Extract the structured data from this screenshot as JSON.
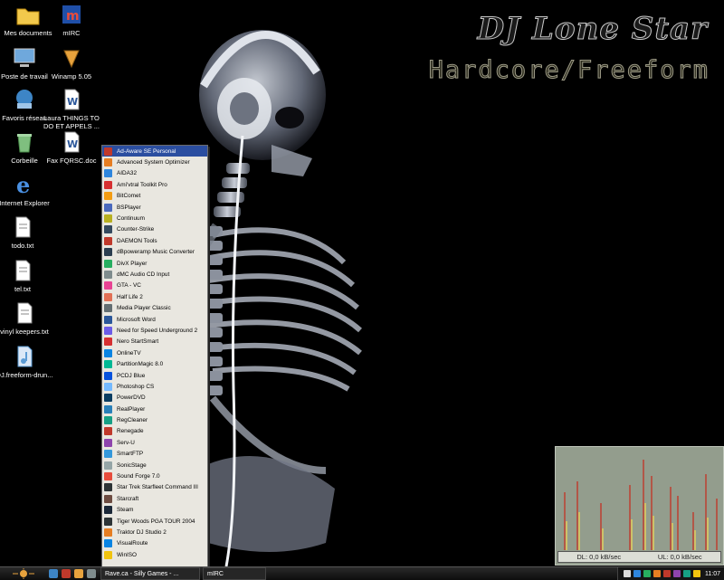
{
  "wallpaper": {
    "title": "DJ Lone Star",
    "subtitle": "Hardcore/Freeform"
  },
  "desktop_icons": [
    {
      "label": "Mes documents",
      "icon": "folder-icon",
      "color": "#f2c94c"
    },
    {
      "label": "Poste de travail",
      "icon": "computer-icon",
      "color": "#6fa8dc"
    },
    {
      "label": "Favoris réseau",
      "icon": "network-icon",
      "color": "#3d85c6"
    },
    {
      "label": "Corbeille",
      "icon": "recycle-bin-icon",
      "color": "#7fbf7f"
    },
    {
      "label": "Internet Explorer",
      "icon": "internet-explorer-icon",
      "color": "#4a90e2"
    },
    {
      "label": "todo.txt",
      "icon": "text-file-icon",
      "color": "#ffffff"
    },
    {
      "label": "tel.txt",
      "icon": "text-file-icon",
      "color": "#ffffff"
    },
    {
      "label": "vinyl keepers.txt",
      "icon": "text-file-icon",
      "color": "#ffffff"
    },
    {
      "label": "DJ.freeform-drun...",
      "icon": "audio-file-icon",
      "color": "#5b9bd5"
    },
    {
      "label": "mIRC",
      "icon": "mirc-icon",
      "color": "#1f4fa8"
    },
    {
      "label": "Winamp 5.05",
      "icon": "winamp-icon",
      "color": "#e8a33d"
    },
    {
      "label": "Laura THINGS TO DO ET APPELS ...",
      "icon": "word-doc-icon",
      "color": "#2b579a"
    },
    {
      "label": "Fax FQRSC.doc",
      "icon": "word-doc-icon",
      "color": "#2b579a"
    }
  ],
  "start_menu": {
    "items": [
      {
        "label": "Ad-Aware SE Personal",
        "icon": "ad-aware-icon",
        "color": "#c0392b"
      },
      {
        "label": "Advanced System Optimizer",
        "icon": "optimizer-icon",
        "color": "#e67e22"
      },
      {
        "label": "AIDA32",
        "icon": "aida32-icon",
        "color": "#2e86de"
      },
      {
        "label": "Ami'vtral Toolkit Pro",
        "icon": "toolkit-icon",
        "color": "#d63031"
      },
      {
        "label": "BitComet",
        "icon": "bitcomet-icon",
        "color": "#f39c12"
      },
      {
        "label": "BSPlayer",
        "icon": "bsplayer-icon",
        "color": "#4a69bd"
      },
      {
        "label": "Continuum",
        "icon": "continuum-icon",
        "color": "#b8b020"
      },
      {
        "label": "Counter-Strike",
        "icon": "counter-strike-icon",
        "color": "#34495e"
      },
      {
        "label": "DAEMON Tools",
        "icon": "daemon-tools-icon",
        "color": "#c0392b"
      },
      {
        "label": "dBpoweramp Music Converter",
        "icon": "dbpoweramp-icon",
        "color": "#2c3e50"
      },
      {
        "label": "DivX Player",
        "icon": "divx-icon",
        "color": "#27ae60"
      },
      {
        "label": "dMC Audio CD Input",
        "icon": "dmc-icon",
        "color": "#7f8c8d"
      },
      {
        "label": "GTA - VC",
        "icon": "gta-icon",
        "color": "#e84393"
      },
      {
        "label": "Half Life 2",
        "icon": "half-life-icon",
        "color": "#e17055"
      },
      {
        "label": "Media Player Classic",
        "icon": "media-player-icon",
        "color": "#636e72"
      },
      {
        "label": "Microsoft Word",
        "icon": "word-icon",
        "color": "#2b579a"
      },
      {
        "label": "Need for Speed Underground 2",
        "icon": "nfs-icon",
        "color": "#6c5ce7"
      },
      {
        "label": "Nero StartSmart",
        "icon": "nero-icon",
        "color": "#d63031"
      },
      {
        "label": "OnlineTV",
        "icon": "onlinetv-icon",
        "color": "#0984e3"
      },
      {
        "label": "PartitionMagic 8.0",
        "icon": "partitionmagic-icon",
        "color": "#00b894"
      },
      {
        "label": "PCDJ Blue",
        "icon": "pcdj-icon",
        "color": "#0652dd"
      },
      {
        "label": "Photoshop CS",
        "icon": "photoshop-icon",
        "color": "#74b9ff"
      },
      {
        "label": "PowerDVD",
        "icon": "powerdvd-icon",
        "color": "#0a3d62"
      },
      {
        "label": "RealPlayer",
        "icon": "realplayer-icon",
        "color": "#2980b9"
      },
      {
        "label": "RegCleaner",
        "icon": "regcleaner-icon",
        "color": "#16a085"
      },
      {
        "label": "Renegade",
        "icon": "renegade-icon",
        "color": "#c0392b"
      },
      {
        "label": "Serv-U",
        "icon": "serv-u-icon",
        "color": "#8e44ad"
      },
      {
        "label": "SmartFTP",
        "icon": "smartftp-icon",
        "color": "#3498db"
      },
      {
        "label": "SonicStage",
        "icon": "sonicstage-icon",
        "color": "#95a5a6"
      },
      {
        "label": "Sound Forge 7.0",
        "icon": "sound-forge-icon",
        "color": "#e74c3c"
      },
      {
        "label": "Star Trek Starfleet Command III",
        "icon": "star-trek-icon",
        "color": "#2d3436"
      },
      {
        "label": "Starcraft",
        "icon": "starcraft-icon",
        "color": "#6d4c41"
      },
      {
        "label": "Steam",
        "icon": "steam-icon",
        "color": "#1b2838"
      },
      {
        "label": "Tiger Woods PGA TOUR 2004",
        "icon": "tiger-woods-icon",
        "color": "#2d3436"
      },
      {
        "label": "Traktor DJ Studio 2",
        "icon": "traktor-icon",
        "color": "#e67e22"
      },
      {
        "label": "VisualRoute",
        "icon": "visualroute-icon",
        "color": "#0984e3"
      },
      {
        "label": "WinISO",
        "icon": "winiso-icon",
        "color": "#f1c40f"
      }
    ]
  },
  "netmon": {
    "download": "DL: 0,0 kB/sec",
    "upload": "UL: 0,0 kB/sec",
    "colors": {
      "red": "#c0392b",
      "yellow": "#e6d25a",
      "bg": "#939d8d"
    }
  },
  "taskbar": {
    "tasks": [
      "Rave.ca - Silly Games - ...",
      "mIRC"
    ],
    "clock": "11:07"
  }
}
